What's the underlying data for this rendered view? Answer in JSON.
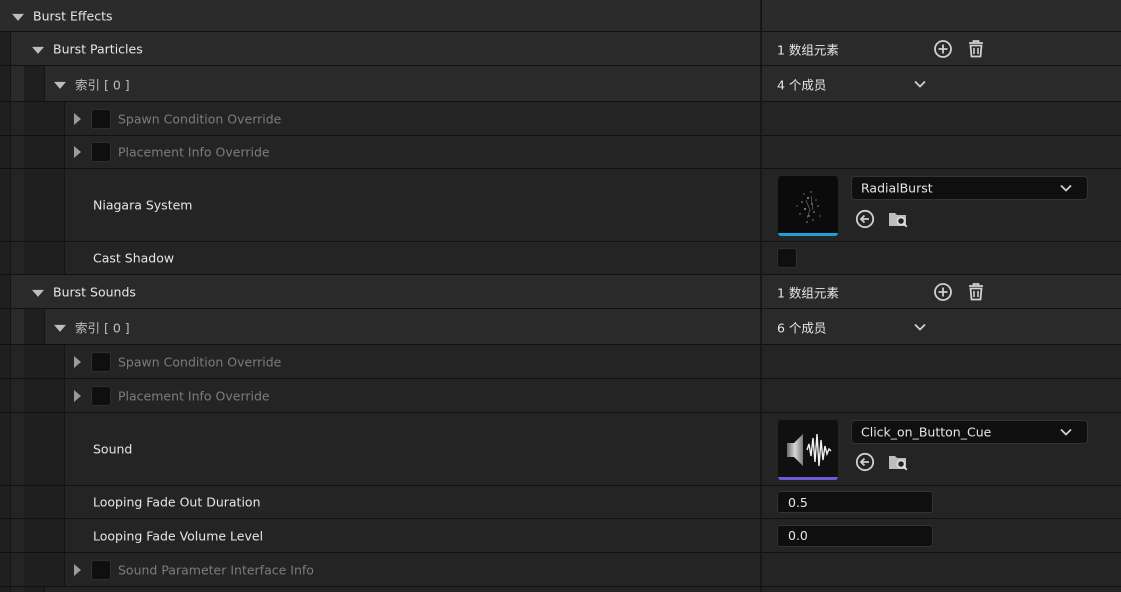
{
  "burst_effects": {
    "label": "Burst Effects"
  },
  "burst_particles": {
    "label": "Burst Particles",
    "count": "1 数组元素",
    "index": {
      "label": "索引 [ 0 ]",
      "members": "4 个成员"
    },
    "spawn_condition": "Spawn Condition Override",
    "placement_info": "Placement Info Override",
    "niagara": {
      "label": "Niagara System",
      "asset": "RadialBurst"
    },
    "cast_shadow": "Cast Shadow"
  },
  "burst_sounds": {
    "label": "Burst Sounds",
    "count": "1 数组元素",
    "index": {
      "label": "索引 [ 0 ]",
      "members": "6 个成员"
    },
    "spawn_condition": "Spawn Condition Override",
    "placement_info": "Placement Info Override",
    "sound": {
      "label": "Sound",
      "asset": "Click_on_Button_Cue"
    },
    "fade_out": {
      "label": "Looping Fade Out Duration",
      "value": "0.5"
    },
    "fade_volume": {
      "label": "Looping Fade Volume Level",
      "value": "0.0"
    },
    "sound_param": "Sound Parameter Interface Info"
  },
  "colors": {
    "niagara_accent": "#1fa3d6",
    "sound_accent": "#6c5bd6"
  },
  "icons": [
    "expand-arrow-icon",
    "collapse-arrow-icon",
    "add-element-icon",
    "delete-icon",
    "chevron-down-icon",
    "use-selected-asset-icon",
    "browse-asset-icon"
  ]
}
